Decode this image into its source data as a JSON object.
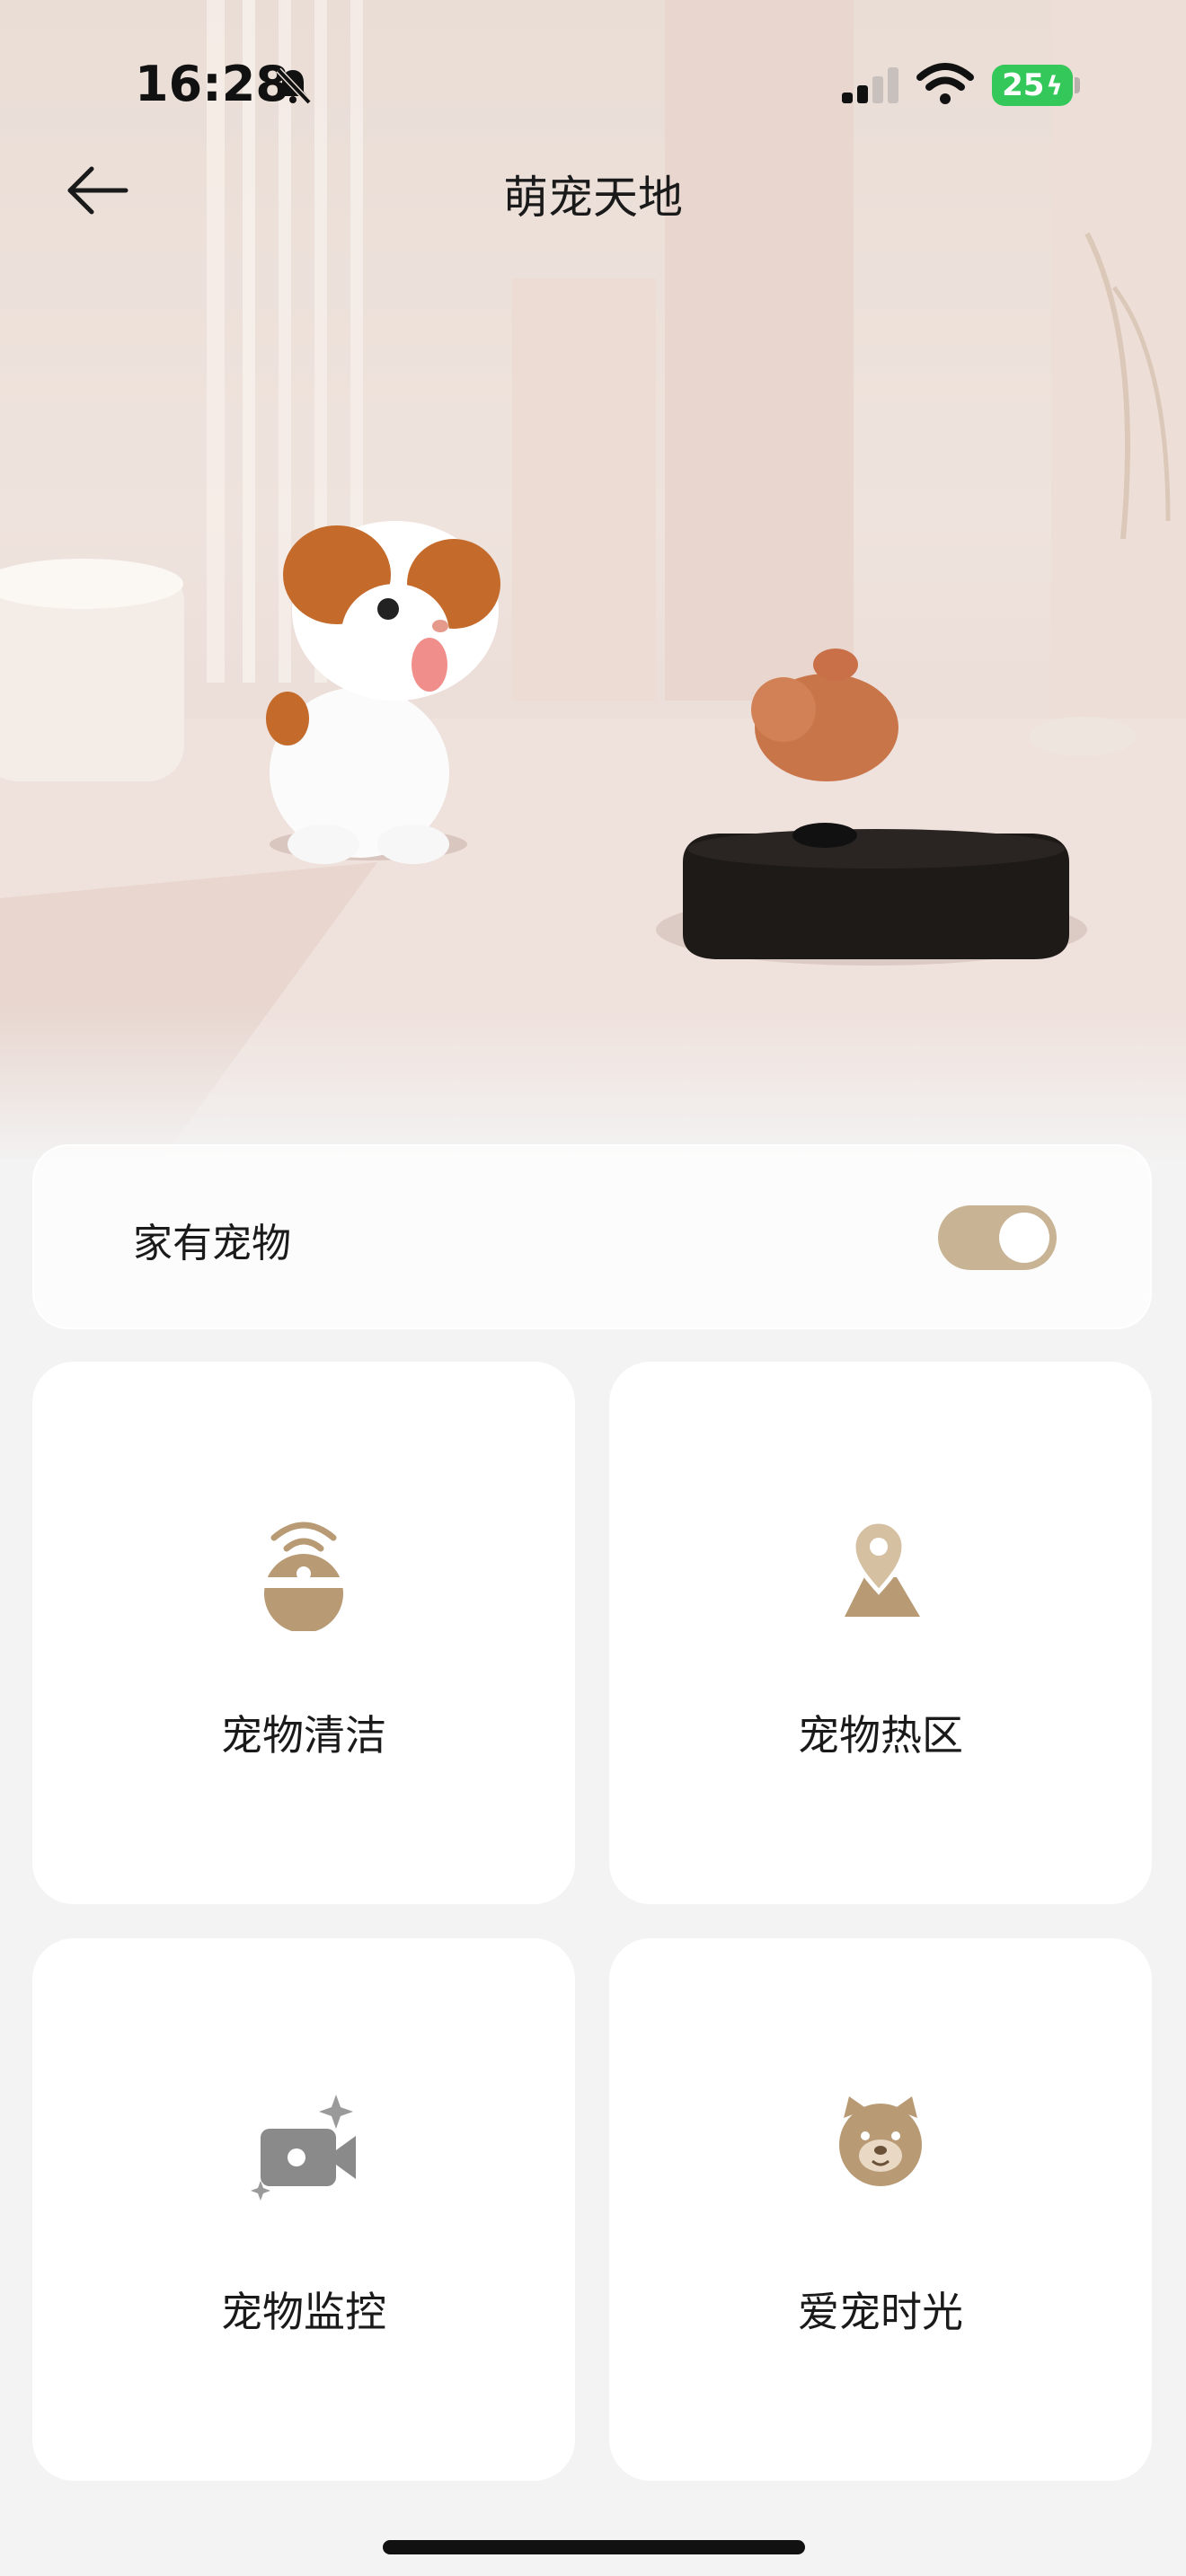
{
  "status_bar": {
    "time": "16:28",
    "battery": "25",
    "icons": [
      "bell-off-icon",
      "signal-icon",
      "wifi-icon",
      "battery-icon"
    ]
  },
  "nav": {
    "title": "萌宠天地",
    "back_icon": "arrow-left-icon"
  },
  "pet_toggle": {
    "label": "家有宠物",
    "enabled": true,
    "accent_color": "#c8b494"
  },
  "features": [
    {
      "label": "宠物清洁",
      "icon": "robot-vacuum-icon",
      "color": "#b89a74"
    },
    {
      "label": "宠物热区",
      "icon": "map-pin-icon",
      "color": "#b89a74"
    },
    {
      "label": "宠物监控",
      "icon": "video-camera-icon",
      "color": "#8c8c8c"
    },
    {
      "label": "爱宠时光",
      "icon": "bear-face-icon",
      "color": "#b89a74"
    }
  ]
}
